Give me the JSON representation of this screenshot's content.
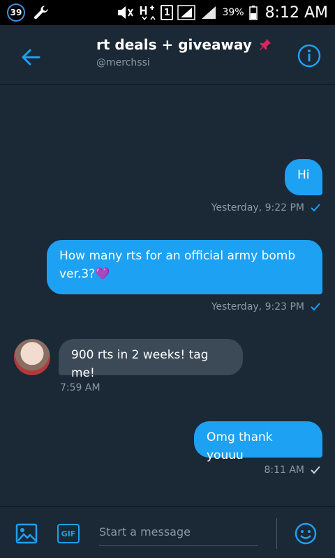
{
  "status_bar": {
    "badge": "39",
    "sim": "1",
    "battery": "39%",
    "time": "8:12 AM"
  },
  "header": {
    "title": "rt deals + giveaway",
    "handle": "@merchssi"
  },
  "messages": [
    {
      "text": "Hi",
      "time": "Yesterday, 9:22 PM"
    },
    {
      "text": "How many rts for an official army bomb ver.3?💜",
      "time": "Yesterday, 9:23 PM"
    },
    {
      "text": "900 rts in 2 weeks! tag me!",
      "time": "7:59 AM"
    },
    {
      "text": "Omg thank youuu",
      "time": "8:11 AM"
    }
  ],
  "composer": {
    "gif_label": "GIF",
    "placeholder": "Start a message"
  },
  "colors": {
    "background": "#1b2836",
    "accent": "#1da1f2",
    "received_bubble": "#3c4a58",
    "meta_text": "#8899a6"
  },
  "icons": {
    "back": "arrow-left-icon",
    "info": "info-icon",
    "pin": "pushpin-icon",
    "image": "image-icon",
    "emoji": "smiley-icon"
  }
}
